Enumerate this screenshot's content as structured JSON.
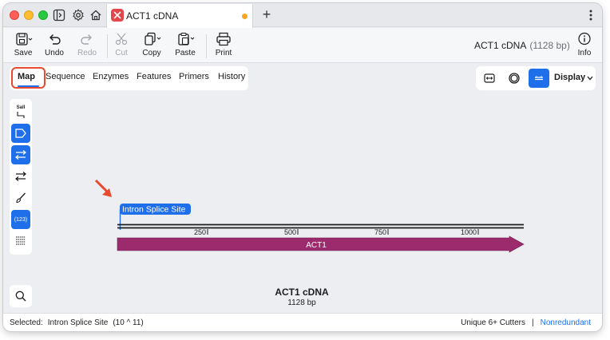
{
  "tab": {
    "title": "ACT1 cDNA"
  },
  "toolbar": {
    "save": "Save",
    "undo": "Undo",
    "redo": "Redo",
    "cut": "Cut",
    "copy": "Copy",
    "paste": "Paste",
    "print": "Print",
    "info": "Info"
  },
  "document": {
    "name": "ACT1 cDNA",
    "length": "(1128 bp)"
  },
  "view_tabs": [
    "Map",
    "Sequence",
    "Enzymes",
    "Features",
    "Primers",
    "History"
  ],
  "selected_view": "Map",
  "display_menu": {
    "label": "Display"
  },
  "palette": {
    "enzyme_label": "SalI",
    "numbers_label": "(123)"
  },
  "map": {
    "annotation_label": "Intron Splice Site",
    "ticks": [
      "250",
      "500",
      "750",
      "1000"
    ],
    "feature_label": "ACT1",
    "title": "ACT1 cDNA",
    "subtitle": "1128 bp"
  },
  "status": {
    "selected_label": "Selected:",
    "selected_value": "Intron Splice Site",
    "selected_range": "(10 ^ 11)",
    "cutters": "Unique 6+ Cutters",
    "separator": "|",
    "mode": "Nonredundant"
  },
  "colors": {
    "accent": "#1f6feb",
    "feature": "#9c2b6e",
    "annotation_arrow": "#e84a2f",
    "tab_dot": "#f5a623"
  }
}
